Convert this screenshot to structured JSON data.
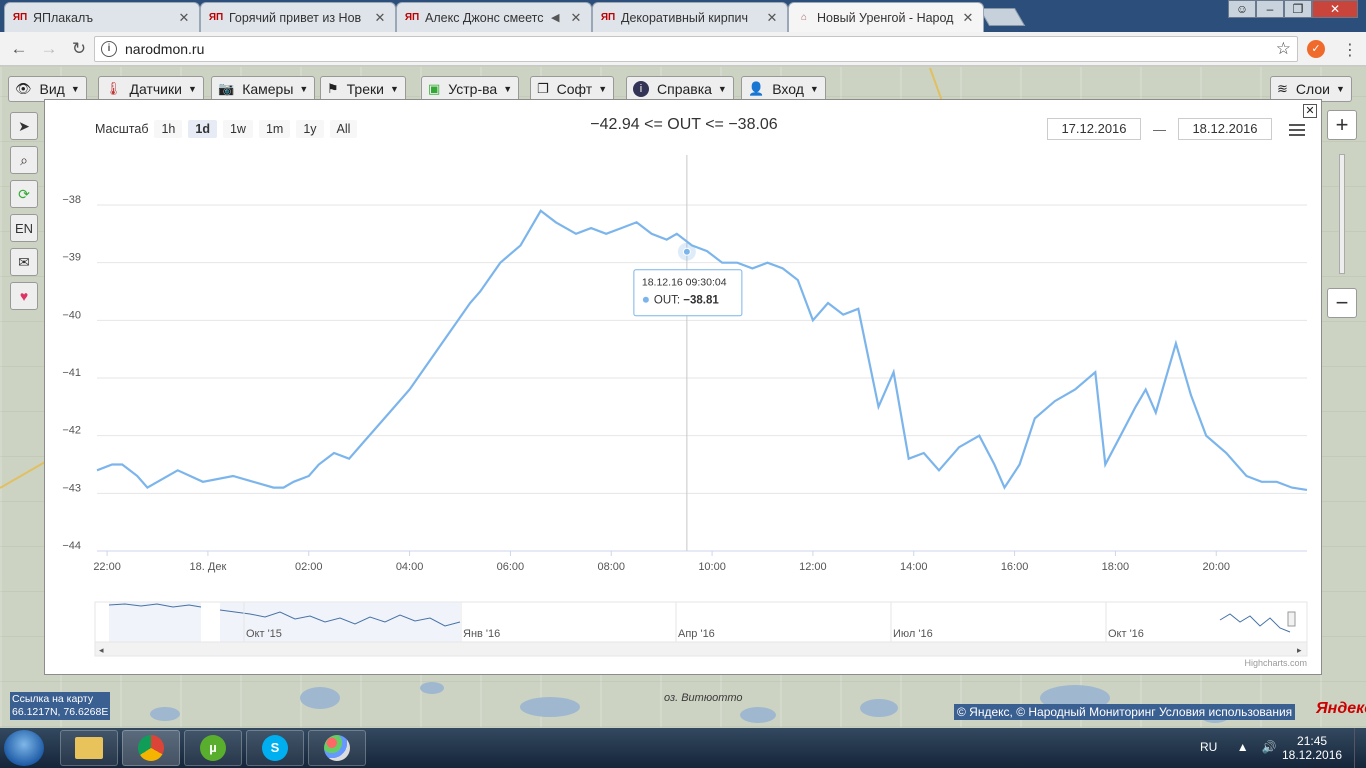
{
  "browser": {
    "tabs": [
      {
        "title": "ЯПлакалъ",
        "active": false,
        "muted": false
      },
      {
        "title": "Горячий привет из Нов",
        "active": false,
        "muted": false
      },
      {
        "title": "Алекс Джонс смеетс",
        "active": false,
        "muted": true
      },
      {
        "title": "Декоративный кирпич",
        "active": false,
        "muted": false
      },
      {
        "title": "Новый Уренгой - Народ",
        "active": true,
        "muted": false
      }
    ],
    "url": "narodmon.ru"
  },
  "map_menu": {
    "items": [
      "Вид",
      "Датчики",
      "Камеры",
      "Треки",
      "Устр-ва",
      "Софт",
      "Справка",
      "Вход"
    ],
    "layers": "Слои"
  },
  "left_tools": {
    "lang": "EN"
  },
  "map": {
    "link_label": "Ссылка на карту",
    "coords": "66.1217N, 76.6268E",
    "copyright": "© Яндекс, © Народный Мониторинг Условия использования",
    "yandex": "Яндекс",
    "lake_name": "оз. Витюотто"
  },
  "chart_ui": {
    "range_label": "Масштаб",
    "range_buttons": [
      "1h",
      "1d",
      "1w",
      "1m",
      "1y",
      "All"
    ],
    "selected_range": "1d",
    "title": "−42.94 <= OUT <= −38.06",
    "date_from": "17.12.2016",
    "date_sep": "—",
    "date_to": "18.12.2016",
    "credit": "Highcharts.com",
    "tooltip_time": "18.12.16 09:30:04",
    "tooltip_series": "OUT",
    "tooltip_value": "−38.81",
    "navigator_labels": [
      "Окт '15",
      "Янв '16",
      "Апр '16",
      "Июл '16",
      "Окт '16"
    ]
  },
  "chart_data": {
    "type": "line",
    "title": "",
    "xlabel": "",
    "ylabel": "",
    "ylim": [
      -44,
      -38
    ],
    "yticks": [
      -38,
      -39,
      -40,
      -41,
      -42,
      -43,
      -44
    ],
    "x_tick_labels": [
      "22:00",
      "18. Дек",
      "02:00",
      "04:00",
      "06:00",
      "08:00",
      "10:00",
      "12:00",
      "14:00",
      "16:00",
      "18:00",
      "20:00"
    ],
    "x_range_hours": [
      21.8,
      45.8
    ],
    "series": [
      {
        "name": "OUT",
        "color": "#7cb5ec",
        "x": [
          21.8,
          22.1,
          22.3,
          22.6,
          22.8,
          23.4,
          23.9,
          24.5,
          24.9,
          25.3,
          25.5,
          25.7,
          26.0,
          26.2,
          26.5,
          26.8,
          27.1,
          27.3,
          27.6,
          28.0,
          28.4,
          28.8,
          29.2,
          29.4,
          29.8,
          30.2,
          30.6,
          30.9,
          31.3,
          31.6,
          31.9,
          32.2,
          32.5,
          32.8,
          33.1,
          33.3,
          33.6,
          33.9,
          34.2,
          34.5,
          34.8,
          35.1,
          35.4,
          35.7,
          36.0,
          36.3,
          36.6,
          36.9,
          37.3,
          37.6,
          37.9,
          38.2,
          38.5,
          38.9,
          39.3,
          39.6,
          39.8,
          40.1,
          40.4,
          40.8,
          41.2,
          41.6,
          41.8,
          42.1,
          42.4,
          42.6,
          42.8,
          43.2,
          43.5,
          43.8,
          44.2,
          44.6,
          44.9,
          45.2,
          45.5,
          45.8
        ],
        "y": [
          -42.6,
          -42.5,
          -42.5,
          -42.7,
          -42.9,
          -42.6,
          -42.8,
          -42.7,
          -42.8,
          -42.9,
          -42.9,
          -42.8,
          -42.7,
          -42.5,
          -42.3,
          -42.4,
          -42.1,
          -41.9,
          -41.6,
          -41.2,
          -40.7,
          -40.2,
          -39.7,
          -39.5,
          -39.0,
          -38.7,
          -38.1,
          -38.3,
          -38.5,
          -38.4,
          -38.5,
          -38.4,
          -38.3,
          -38.5,
          -38.6,
          -38.5,
          -38.7,
          -38.8,
          -39.0,
          -39.0,
          -39.1,
          -39.0,
          -39.1,
          -39.3,
          -40.0,
          -39.7,
          -39.9,
          -39.8,
          -41.5,
          -40.9,
          -42.4,
          -42.3,
          -42.6,
          -42.2,
          -42.0,
          -42.5,
          -42.9,
          -42.5,
          -41.7,
          -41.4,
          -41.2,
          -40.9,
          -42.5,
          -42.0,
          -41.5,
          -41.2,
          -41.6,
          -40.4,
          -41.3,
          -42.0,
          -42.3,
          -42.7,
          -42.8,
          -42.8,
          -42.9,
          -42.94
        ]
      }
    ],
    "tooltip": {
      "x": 33.5,
      "y": -38.81
    },
    "legend": "none",
    "grid": true
  }
}
